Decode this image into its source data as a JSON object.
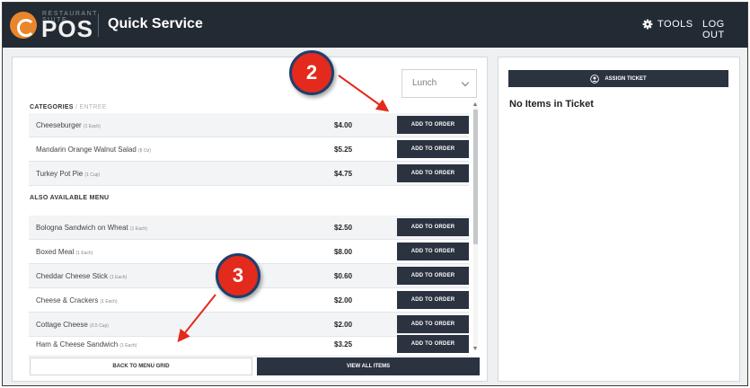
{
  "header": {
    "logo_sub": "RESTAURANT SUITE",
    "logo_text": "POS",
    "title": "Quick Service",
    "tools_label": "TOOLS",
    "logout_label": "LOG OUT"
  },
  "menu": {
    "meal_select": "Lunch",
    "categories_label": "CATEGORIES",
    "categories_sep": " / ",
    "category_current": "ENTREE",
    "entree_items": [
      {
        "name": "Cheeseburger",
        "unit": "(1 Each)",
        "price": "$4.00",
        "button": "ADD TO ORDER"
      },
      {
        "name": "Mandarin Orange Walnut Salad",
        "unit": "(8 Oz)",
        "price": "$5.25",
        "button": "ADD TO ORDER"
      },
      {
        "name": "Turkey Pot Pie",
        "unit": "(1 Cup)",
        "price": "$4.75",
        "button": "ADD TO ORDER"
      }
    ],
    "also_label": "ALSO AVAILABLE MENU",
    "also_items": [
      {
        "name": "Bologna Sandwich on Wheat",
        "unit": "(1 Each)",
        "price": "$2.50",
        "button": "ADD TO ORDER"
      },
      {
        "name": "Boxed Meal",
        "unit": "(1 Each)",
        "price": "$8.00",
        "button": "ADD TO ORDER"
      },
      {
        "name": "Cheddar Cheese Stick",
        "unit": "(1 Each)",
        "price": "$0.60",
        "button": "ADD TO ORDER"
      },
      {
        "name": "Cheese & Crackers",
        "unit": "(1 Each)",
        "price": "$2.00",
        "button": "ADD TO ORDER"
      },
      {
        "name": "Cottage Cheese",
        "unit": "(0.5 Cup)",
        "price": "$2.00",
        "button": "ADD TO ORDER"
      },
      {
        "name": "Ham & Cheese Sandwich",
        "unit": "(1 Each)",
        "price": "$3.25",
        "button": "ADD TO ORDER"
      }
    ],
    "back_button": "BACK TO MENU GRID",
    "view_all_button": "VIEW ALL ITEMS"
  },
  "ticket": {
    "assign_button": "ASSIGN TICKET",
    "empty_message": "No Items in Ticket"
  },
  "callouts": {
    "step_2": "2",
    "step_3": "3"
  },
  "colors": {
    "topbar": "#222a33",
    "button_dark": "#2b3240",
    "logo_orange": "#e9852b",
    "callout_red": "#e32a1c",
    "callout_border": "#1d3f6e"
  }
}
